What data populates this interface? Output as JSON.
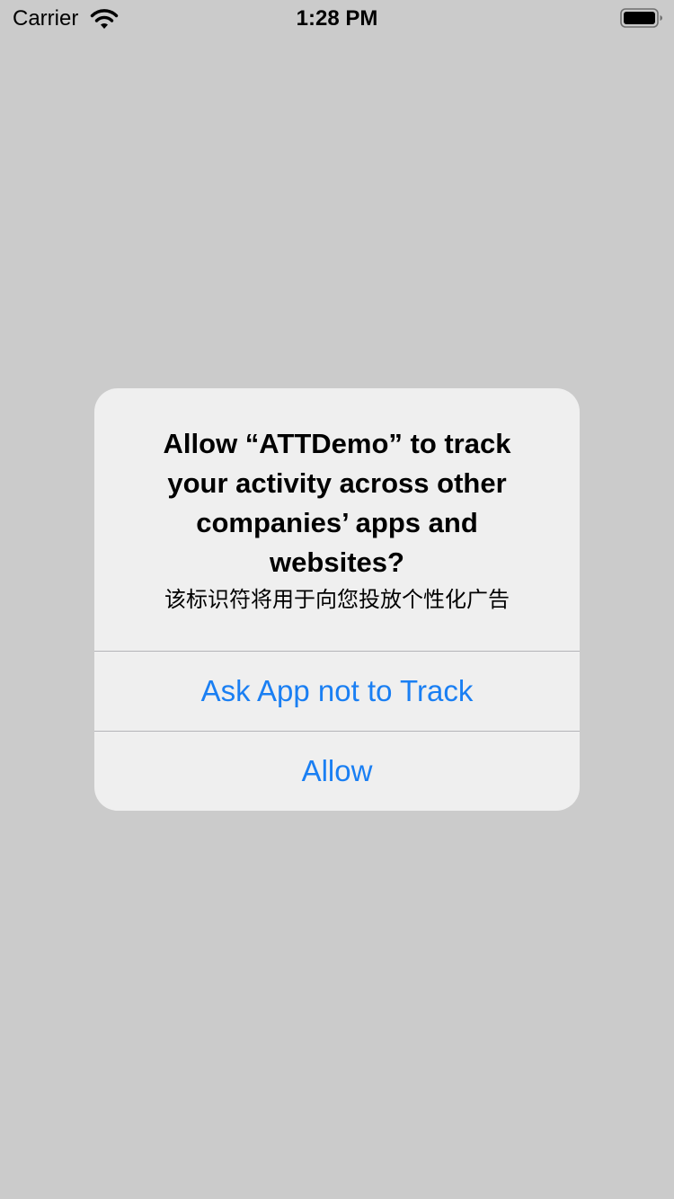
{
  "status_bar": {
    "carrier": "Carrier",
    "time": "1:28 PM",
    "wifi_icon": "wifi-icon",
    "battery_icon": "battery-icon"
  },
  "alert": {
    "title": "Allow “ATTDemo” to track your activity across other companies’ apps and websites?",
    "message": "该标识符将用于向您投放个性化广告",
    "actions": [
      {
        "label": "Ask App not to Track"
      },
      {
        "label": "Allow"
      }
    ]
  },
  "colors": {
    "background": "#cbcbcb",
    "alert_background": "#efefef",
    "action_tint": "#1a7ff3",
    "divider": "#b4b4b8"
  }
}
